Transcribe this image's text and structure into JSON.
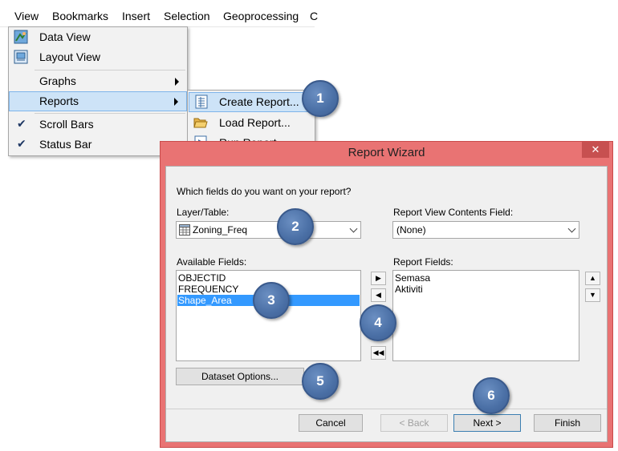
{
  "menubar": {
    "items": [
      "View",
      "Bookmarks",
      "Insert",
      "Selection",
      "Geoprocessing"
    ],
    "overflow": "C"
  },
  "view_menu": {
    "items": [
      {
        "label": "Data View",
        "icon": "data-view-icon"
      },
      {
        "label": "Layout View",
        "icon": "layout-view-icon"
      },
      {
        "label": "Graphs",
        "submenu": true
      },
      {
        "label": "Reports",
        "submenu": true,
        "highlighted": true
      },
      {
        "label": "Scroll Bars",
        "checked": true
      },
      {
        "label": "Status Bar",
        "checked": true
      }
    ]
  },
  "reports_submenu": {
    "items": [
      {
        "label": "Create Report...",
        "icon": "create-report-icon",
        "highlighted": true
      },
      {
        "label": "Load Report...",
        "icon": "open-folder-icon"
      },
      {
        "label": "Run Report...",
        "icon": "run-report-icon"
      }
    ]
  },
  "wizard": {
    "title": "Report Wizard",
    "close_glyph": "✕",
    "prompt": "Which fields do you want on your report?",
    "layer_label": "Layer/Table:",
    "layer_value": "Zoning_Freq",
    "contents_label": "Report View Contents Field:",
    "contents_value": "(None)",
    "available_label": "Available Fields:",
    "available_fields": [
      "OBJECTID",
      "FREQUENCY",
      "Shape_Area"
    ],
    "selected_available": "Shape_Area",
    "report_label": "Report Fields:",
    "report_fields": [
      "Semasa",
      "Aktiviti"
    ],
    "dataset_options": "Dataset Options...",
    "buttons": {
      "cancel": "Cancel",
      "back": "< Back",
      "next": "Next >",
      "finish": "Finish"
    }
  },
  "callouts": [
    "1",
    "2",
    "3",
    "4",
    "5",
    "6"
  ],
  "colors": {
    "title_bar": "#e97373",
    "highlight": "#cde3f7",
    "selection": "#3399ff",
    "callout": "#4a6fa5"
  }
}
